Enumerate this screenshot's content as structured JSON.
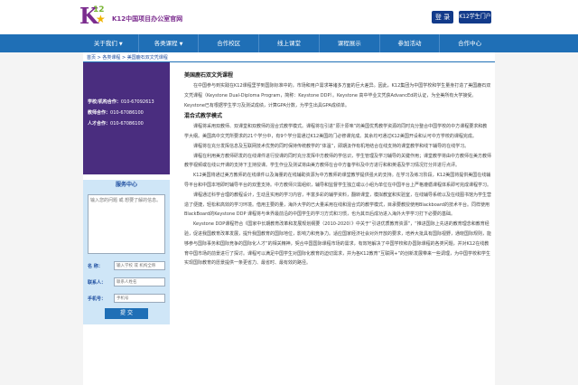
{
  "header": {
    "logo_k": "K",
    "logo_12": "12",
    "site_title": "K12中国项目办公室官网",
    "login_label": "登 录",
    "portal_label": "K12学生门户"
  },
  "nav": [
    {
      "label": "关于我们",
      "caret": "▼"
    },
    {
      "label": "各类课程",
      "caret": "▼"
    },
    {
      "label": "合作校区",
      "caret": ""
    },
    {
      "label": "线上课堂",
      "caret": ""
    },
    {
      "label": "课程展示",
      "caret": ""
    },
    {
      "label": "参加活动",
      "caret": ""
    },
    {
      "label": "合作中心",
      "caret": ""
    }
  ],
  "breadcrumb": "首页 > 各类课程 > 美国鹿石双文凭课程",
  "contact": {
    "school_label": "学校/机构合作：",
    "school_phone": "010-67092613",
    "teacher_label": "教师合作：",
    "teacher_phone": "010-67086100",
    "hr_label": "人才合作：",
    "hr_phone": "010-67086100"
  },
  "service": {
    "title": "服务中心",
    "textarea_placeholder": "输入您的问题 或 想要了解的信息。",
    "name_label": "名 称：",
    "name_placeholder": "输入学校 或 机构全称",
    "contact_label": "联系人：",
    "contact_placeholder": "联系人姓名",
    "phone_label": "手机号：",
    "phone_placeholder": "手机号",
    "submit_label": "提 交"
  },
  "article": {
    "title": "美国鹿石双文凭课程",
    "p1": "在中国参与到实践在K12课程里学到国际标准中的，市场和用户需求等诸多方面的巨大差异。因此，K12集团为中国学校和学生量身打造了美国鹿石双文凭课程（Keystone Dual-Diploma Program，简称：Keystone DDP）。Keystone 高中毕业文凭获AdvancEd的认证，为全美所有大学接受。Keystone已有根据学生学习及测试成绩，计算GPA分数，为学生出具GPA成绩单。",
    "h2": "混合式教学模式",
    "p2": "课程将采用双教师、双课堂和双教师的混合式教学模式。课程将在引进“原汁原味”的美国优秀教学资源的同时充分整合中国学校的中方课程要求和教学大纲。美国高中文凭所要求的21个学分中，有9个学分需通过K12美国的门必修课完成。其余均可通过K12美国开设和认可中方学校的课程完成。",
    "p3": "课程将在充分发挥信息及互联网技术优势的同时保持传统教学的“体温”，即期汲作有机地结合在线支持的课堂教学和线下辅导的在线学习。",
    "p4": "课程在利用美方教师研发的在线课件进行授课的同时充分发挥中方教师的学信识，学生管理及学习辅导的关键作用；课堂教学将由中方教师在美方教师教学视频或在线公开课的支持下主持授课。学生作业及测试将由美方教师在合中方备学科及中方进行和和英语及学习情况打分并进行点评。",
    "p5": "K12美国将通过美方教师的在线课件以及海量的在线辅助资源为中方教师的课堂教学提供强大的支持。在学习及练习阶段，K12美国将提供美国在线辅导平台和中国本地即时辅导平台的双重支持。中方教师只需组织，辅导和监督学生独立或以小组为单位在中国平台上严格遵循课程体系即可完成课程学习。",
    "p6": "课程通过科学合理的教程设计，生动且实用的学习内容，丰富多彩的辅学资料，翻转课堂，模拟教室和实验室，在线辅导系统以及在线图书馆为学生营造了便捷，轻松和高效的学习环境。借用主要的量，海外大学的已大量采用在线和混合式的教学模式，目承要教授使用Blackboard的技术平台。同样使用BlackBoard的Keystone DDP 课程将与世界最前沿的中国学生的学习方式和习惯，也为其日后成功进入海外大学学习打下必要的基础。",
    "p7": "Keystone DDP课程符合《国家中长期教育改革和发展规划纲要（2010-2020）》中关于“引进优质教育资源”，“推进国际上先进的教育理念和教育经验，促进我国教育改革发展，提升我国教育的国际地位，影响力和竞争力。适应国家经济社会对外开放的要求，培养大批具有国际视野，通晓国际规则，能够参与国际事务和国际竞争的国际化人才”的相关精神，契合中国国际课程市场的需求，有效地解决了中国学校和办国际课程的各类问题，并对K12在线教育中国市场的前景进行了探讨。课程可以满足中国学生对国际化教育的迫切需求，并为各K12教育“互联网+”的创新发展带来一些调理，为中国学校和学生实现国际教育的愿景提供一条更省力、最省时、最有效的路径。"
  }
}
